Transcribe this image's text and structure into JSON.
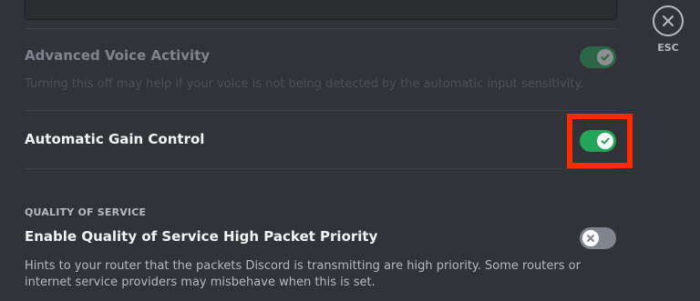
{
  "close": {
    "label": "ESC"
  },
  "settings": [
    {
      "label": "Advanced Voice Activity",
      "description": "Turning this off may help if your voice is not being detected by the automatic input sensitivity.",
      "enabled": true,
      "disabled": true
    },
    {
      "label": "Automatic Gain Control",
      "enabled": true,
      "disabled": false
    }
  ],
  "qos": {
    "section_header": "QUALITY OF SERVICE",
    "label": "Enable Quality of Service High Packet Priority",
    "description": "Hints to your router that the packets Discord is transmitting are high priority. Some routers or internet service providers may misbehave when this is set.",
    "enabled": false
  },
  "colors": {
    "background": "#313338",
    "toggle_on": "#23a55a",
    "toggle_off": "#80848e",
    "highlight": "#ff2a00"
  },
  "icons": {
    "close": "close-icon",
    "check": "check-icon",
    "x": "x-icon"
  }
}
